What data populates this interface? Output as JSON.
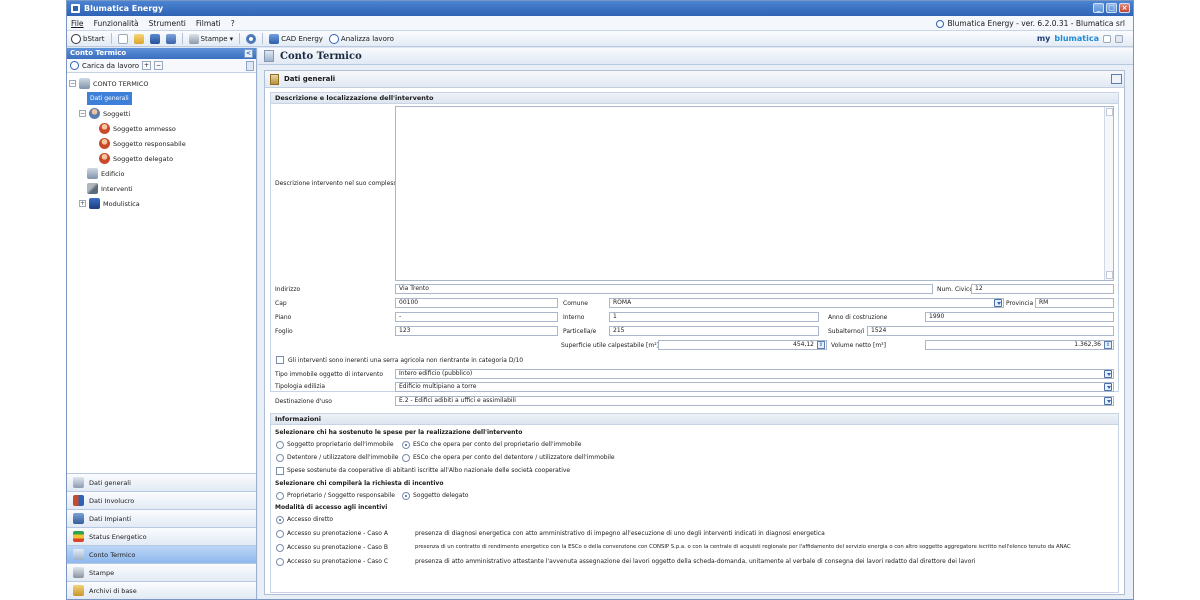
{
  "window": {
    "title": "Blumatica Energy",
    "version": "Blumatica Energy - ver. 6.2.0.31 - Blumatica srl"
  },
  "menu": [
    "File",
    "Funzionalità",
    "Strumenti",
    "Filmati",
    "?"
  ],
  "toolbar": {
    "bstart": "bStart",
    "stampe": "Stampe",
    "cad": "CAD Energy",
    "analizza": "Analizza lavoro",
    "brand_my": "my",
    "brand_name": "blumatica"
  },
  "sidebar": {
    "title": "Conto Termico",
    "load_label": "Carica da lavoro",
    "tree": {
      "root": "CONTO TERMICO",
      "dati_generali": "Dati generali",
      "soggetti": "Soggetti",
      "soggetto_ammesso": "Soggetto ammesso",
      "soggetto_responsabile": "Soggetto responsabile",
      "soggetto_delegato": "Soggetto delegato",
      "edificio": "Edificio",
      "interventi": "Interventi",
      "modulistica": "Modulistica"
    },
    "nav": [
      "Dati generali",
      "Dati Involucro",
      "Dati Impianti",
      "Status Energetico",
      "Conto Termico",
      "Stampe",
      "Archivi di base"
    ]
  },
  "main": {
    "title": "Conto Termico",
    "card_title": "Dati generali",
    "sec1_title": "Descrizione e localizzazione dell'intervento",
    "descrizione_label": "Descrizione intervento nel suo complesso",
    "indirizzo_label": "Indirizzo",
    "indirizzo": "Via Trento",
    "num_civico_label": "Num. Civico",
    "num_civico": "12",
    "cap_label": "Cap",
    "cap": "00100",
    "comune_label": "Comune",
    "comune": "ROMA",
    "provincia_label": "Provincia",
    "provincia": "RM",
    "piano_label": "Piano",
    "piano": "-",
    "interno_label": "Interno",
    "interno": "1",
    "anno_label": "Anno di costruzione",
    "anno": "1990",
    "foglio_label": "Foglio",
    "foglio": "123",
    "particella_label": "Particella/e",
    "particella": "215",
    "subalterno_label": "Subalterno/i",
    "subalterno": "1524",
    "superficie_label": "Superficie utile calpestabile [m²]",
    "superficie": "454,12",
    "volume_label": "Volume netto [m³]",
    "volume": "1.362,36",
    "serra_label": "Gli interventi sono inerenti una serra agricola non rientrante in categoria D/10",
    "tipo_immobile_label": "Tipo immobile oggetto di intervento",
    "tipo_immobile": "Intero edificio (pubblico)",
    "tipologia_label": "Tipologia edilizia",
    "tipologia": "Edificio multipiano a torre",
    "destinazione_label": "Destinazione d'uso",
    "destinazione": "E.2 - Edifici adibiti a uffici e assimilabili",
    "sec2_title": "Informazioni",
    "spese_title": "Selezionare chi ha sostenuto le spese per la realizzazione dell'intervento",
    "r_proprietario": "Soggetto proprietario dell'immobile",
    "r_esco_proprietario": "ESCo che opera per conto del proprietario dell'immobile",
    "r_detentore": "Detentore / utilizzatore dell'immobile",
    "r_esco_detentore": "ESCo che opera per conto del detentore / utilizzatore dell'immobile",
    "cooperative_label": "Spese sostenute da cooperative di abitanti iscritte all'Albo nazionale delle società cooperative",
    "richiesta_title": "Selezionare chi compilerà la richiesta di incentivo",
    "r_prop_resp": "Proprietario / Soggetto responsabile",
    "r_delegato": "Soggetto delegato",
    "accesso_title": "Modalità di accesso agli incentivi",
    "r_diretto": "Accesso diretto",
    "r_caso_a": "Accesso su prenotazione - Caso A",
    "desc_caso_a": "presenza di diagnosi energetica con atto amministrativo di impegno all'esecuzione di uno degli interventi indicati in diagnosi energetica",
    "r_caso_b": "Accesso su prenotazione - Caso B",
    "desc_caso_b": "presenza di un contratto di rendimento energetico con la ESCo o della convenzione con CONSIP S.p.a. o con la centrale di acquisti regionale per l'affidamento del servizio energia o con altro soggetto aggregatore iscritto nell'elenco tenuto da ANAC",
    "r_caso_c": "Accesso su prenotazione - Caso C",
    "desc_caso_c": "presenza di atto amministrativo attestante l'avvenuta assegnazione dei lavori oggetto della scheda-domanda, unitamente al verbale di consegna dei lavori redatto dal direttore dei lavori"
  }
}
